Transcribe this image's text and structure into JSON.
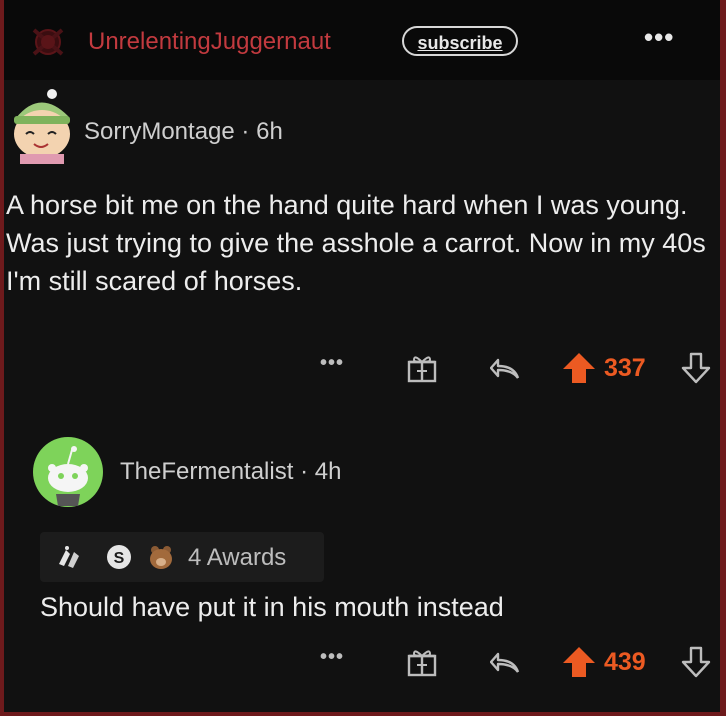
{
  "subreddit": {
    "name": "UnrelentingJuggernaut",
    "subscribe_label": "subscribe",
    "more_label": "•••",
    "accent_color": "#c23a3f"
  },
  "comments": [
    {
      "author": "SorryMontage",
      "separator": "·",
      "time": "6h",
      "body": "A horse bit me on the hand quite hard when I was young. Was just trying to give the asshole a carrot. Now in my 40s I'm still scared of horses.",
      "score": "337",
      "more_label": "•••"
    },
    {
      "author": "TheFermentalist",
      "separator": "·",
      "time": "4h",
      "awards_label": "4 Awards",
      "body": "Should have put it in his mouth instead",
      "score": "439",
      "more_label": "•••"
    }
  ],
  "colors": {
    "upvote": "#ec5a22",
    "background": "#111111",
    "frame": "#6e1a1c"
  }
}
